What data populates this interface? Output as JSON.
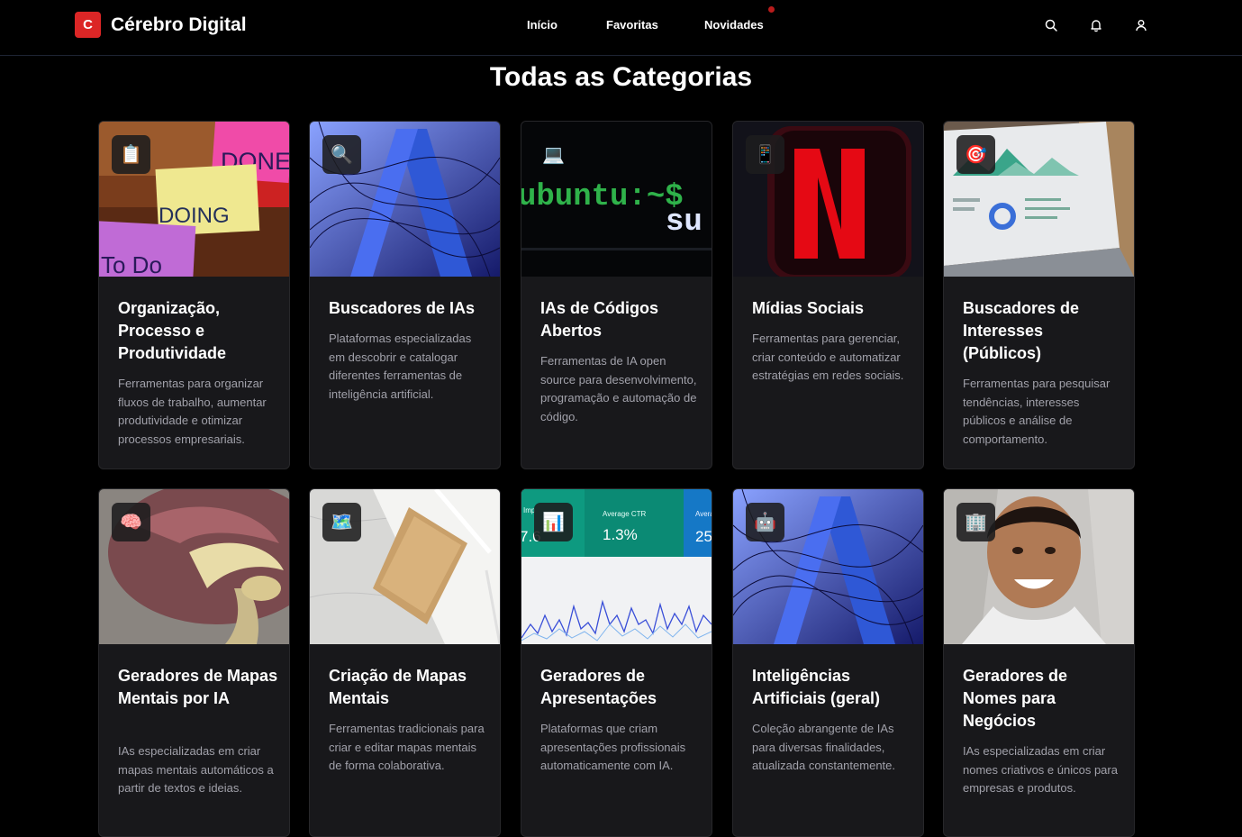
{
  "brand": {
    "logo_letter": "C",
    "name": "Cérebro Digital"
  },
  "nav": {
    "links": [
      "Início",
      "Favoritas",
      "Novidades"
    ]
  },
  "icons": {
    "search": "search-icon",
    "bell": "bell-icon",
    "user": "user-icon"
  },
  "colors": {
    "accent": "#dc2626",
    "background": "#000000",
    "card": "#18181b",
    "muted_text": "#a1a1aa"
  },
  "page": {
    "title": "Todas as Categorias"
  },
  "categories": [
    {
      "emoji": "📋",
      "title": "Organização, Processo e Produtividade",
      "description": "Ferramentas para organizar fluxos de trabalho, aumentar produtividade e otimizar processos empresariais.",
      "image_text": [
        "DONE",
        "DOING",
        "To Do"
      ]
    },
    {
      "emoji": "🔍",
      "title": "Buscadores de IAs",
      "description": "Plataformas especializadas em descobrir e catalogar diferentes ferramentas de inteligência artificial."
    },
    {
      "emoji": "💻",
      "title": "IAs de Códigos Abertos",
      "description": "Ferramentas de IA open source para desenvolvimento, programação e automação de código.",
      "image_text": [
        "ubuntu:~$",
        "su"
      ]
    },
    {
      "emoji": "📱",
      "title": "Mídias Sociais",
      "description": "Ferramentas para gerenciar, criar conteúdo e automatizar estratégias em redes sociais."
    },
    {
      "emoji": "🎯",
      "title": "Buscadores de Interesses (Públicos)",
      "description": "Ferramentas para pesquisar tendências, interesses públicos e análise de comportamento."
    },
    {
      "emoji": "🧠",
      "title": "Geradores de Mapas Mentais por IA",
      "description": "IAs especializadas em criar mapas mentais automáticos a partir de textos e ideias."
    },
    {
      "emoji": "🗺️",
      "title": "Criação de Mapas Mentais",
      "description": "Ferramentas tradicionais para criar e editar mapas mentais de forma colaborativa."
    },
    {
      "emoji": "📊",
      "title": "Geradores de Apresentações",
      "description": "Plataformas que criam apresentações profissionais automaticamente com IA.",
      "image_text": [
        "Average CTR",
        "1.3%",
        "Avera",
        "25",
        "Imp",
        "7.6"
      ]
    },
    {
      "emoji": "🤖",
      "title": "Inteligências Artificiais (geral)",
      "description": "Coleção abrangente de IAs para diversas finalidades, atualizada constantemente."
    },
    {
      "emoji": "🏢",
      "title": "Geradores de Nomes para Negócios",
      "description": "IAs especializadas em criar nomes criativos e únicos para empresas e produtos."
    }
  ]
}
